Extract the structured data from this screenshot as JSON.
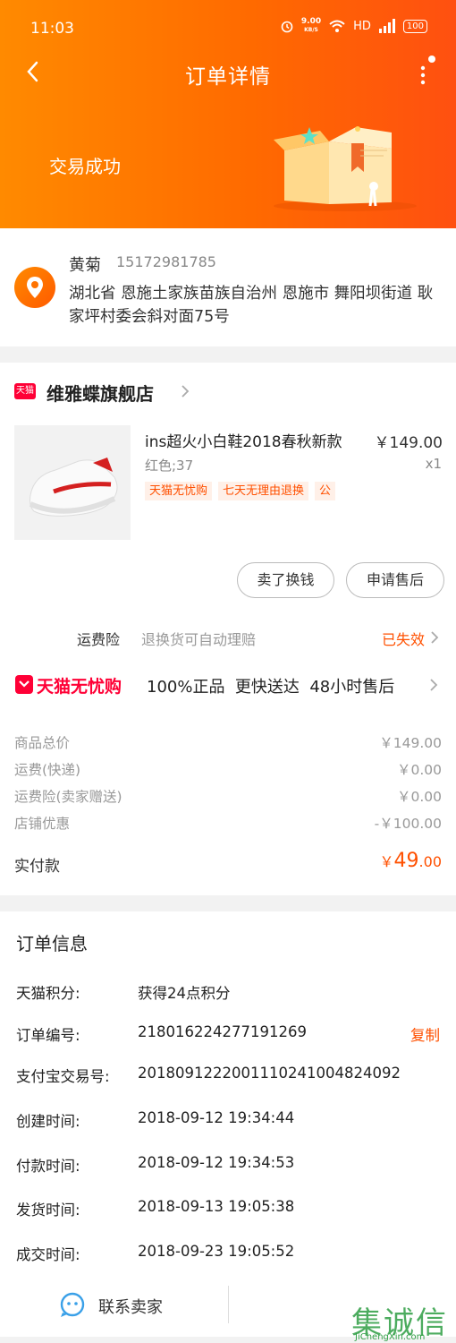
{
  "status_bar": {
    "time": "11:03",
    "net_speed": "9.00",
    "net_unit": "KB/S",
    "network": "HD",
    "battery": "100"
  },
  "nav": {
    "title": "订单详情"
  },
  "order_status": "交易成功",
  "address": {
    "name": "黄菊",
    "phone": "15172981785",
    "detail": "湖北省 恩施土家族苗族自治州 恩施市 舞阳坝街道 耿家坪村委会斜对面75号"
  },
  "shop": {
    "badge": "天猫",
    "name": "维雅蝶旗舰店"
  },
  "product": {
    "title": "ins超火小白鞋2018春秋新款",
    "price": "￥149.00",
    "sku": "红色;37",
    "quantity": "x1",
    "tags": [
      "天猫无忧购",
      "七天无理由退换",
      "公"
    ]
  },
  "actions": {
    "sell_label": "卖了换钱",
    "aftersale_label": "申请售后"
  },
  "insurance": {
    "label": "运费险",
    "desc": "退换货可自动理赔",
    "status": "已失效"
  },
  "wuyougou": {
    "logo_text": "天猫无忧购",
    "desc": "100%正品  更快送达  48小时售后"
  },
  "fees": [
    {
      "label": "商品总价",
      "value": "￥149.00"
    },
    {
      "label": "运费(快递)",
      "value": "￥0.00"
    },
    {
      "label": "运费险(卖家赠送)",
      "value": "￥0.00"
    },
    {
      "label": "店铺优惠",
      "value": "-￥100.00"
    }
  ],
  "payment": {
    "label": "实付款",
    "currency": "￥",
    "integer": "49",
    "decimal": ".00"
  },
  "order_info": {
    "title": "订单信息",
    "rows": [
      {
        "label": "天猫积分:",
        "value": "获得24点积分"
      },
      {
        "label": "订单编号:",
        "value": "218016224277191269"
      },
      {
        "label": "支付宝交易号:",
        "value": "2018091222001110241004824092"
      },
      {
        "label": "创建时间:",
        "value": "2018-09-12 19:34:44"
      },
      {
        "label": "付款时间:",
        "value": "2018-09-12 19:34:53"
      },
      {
        "label": "发货时间:",
        "value": "2018-09-13 19:05:38"
      },
      {
        "label": "成交时间:",
        "value": "2018-09-23 19:05:52"
      }
    ],
    "copy_label": "复制"
  },
  "contact": {
    "label": "联系卖家"
  },
  "watermark": {
    "main": "集诚信",
    "url": "JiChengXin.com"
  }
}
